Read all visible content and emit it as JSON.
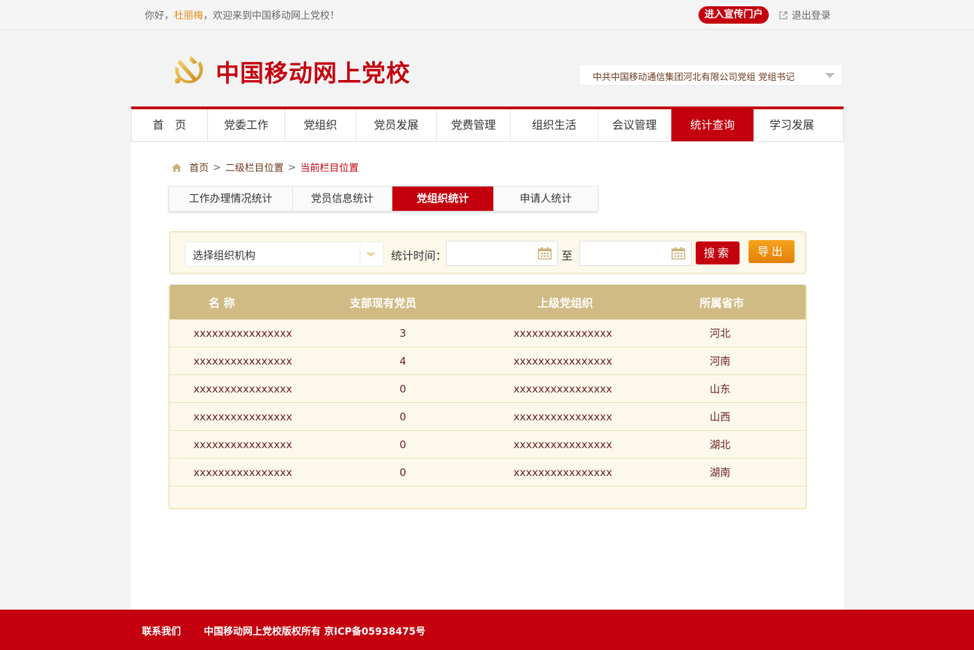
{
  "topbar": {
    "greeting_prefix": "你好，",
    "username": "杜丽梅",
    "greeting_suffix": "，欢迎来到中国移动网上党校！",
    "portal_button": "进入宣传门户",
    "logout": "退出登录"
  },
  "header": {
    "site_title": "中国移动网上党校",
    "org_role": "中共中国移动通信集团河北有限公司党组   党组书记"
  },
  "nav": {
    "items": [
      {
        "label": "首　页"
      },
      {
        "label": "党委工作"
      },
      {
        "label": "党组织"
      },
      {
        "label": "党员发展"
      },
      {
        "label": "党费管理"
      },
      {
        "label": "组织生活"
      },
      {
        "label": "会议管理"
      },
      {
        "label": "统计查询"
      },
      {
        "label": "学习发展"
      }
    ],
    "active_index": 7
  },
  "breadcrumb": {
    "home": "首页",
    "sep": ">",
    "level2": "二级栏目位置",
    "current": "当前栏目位置"
  },
  "subtabs": {
    "items": [
      {
        "label": "工作办理情况统计"
      },
      {
        "label": "党员信息统计"
      },
      {
        "label": "党组织统计"
      },
      {
        "label": "申请人统计"
      }
    ],
    "active_index": 2
  },
  "filter": {
    "org_placeholder": "选择组织机构",
    "time_label": "统计时间：",
    "start_date": "",
    "to_label": "至",
    "end_date": "",
    "search_button": "搜索",
    "export_button": "导出"
  },
  "table": {
    "headers": [
      "名 称",
      "支部现有党员",
      "上级党组织",
      "所属省市"
    ],
    "rows": [
      [
        "xxxxxxxxxxxxxxxx",
        "3",
        "xxxxxxxxxxxxxxxx",
        "河北"
      ],
      [
        "xxxxxxxxxxxxxxxx",
        "4",
        "xxxxxxxxxxxxxxxx",
        "河南"
      ],
      [
        "xxxxxxxxxxxxxxxx",
        "0",
        "xxxxxxxxxxxxxxxx",
        "山东"
      ],
      [
        "xxxxxxxxxxxxxxxx",
        "0",
        "xxxxxxxxxxxxxxxx",
        "山西"
      ],
      [
        "xxxxxxxxxxxxxxxx",
        "0",
        "xxxxxxxxxxxxxxxx",
        "湖北"
      ],
      [
        "xxxxxxxxxxxxxxxx",
        "0",
        "xxxxxxxxxxxxxxxx",
        "湖南"
      ]
    ]
  },
  "footer": {
    "contact": "联系我们",
    "copyright": "中国移动网上党校版权所有   京ICP备05938475号"
  },
  "colors": {
    "brand_red": "#c4000e",
    "table_header": "#d1bb85",
    "export_orange": "#e47f06"
  }
}
